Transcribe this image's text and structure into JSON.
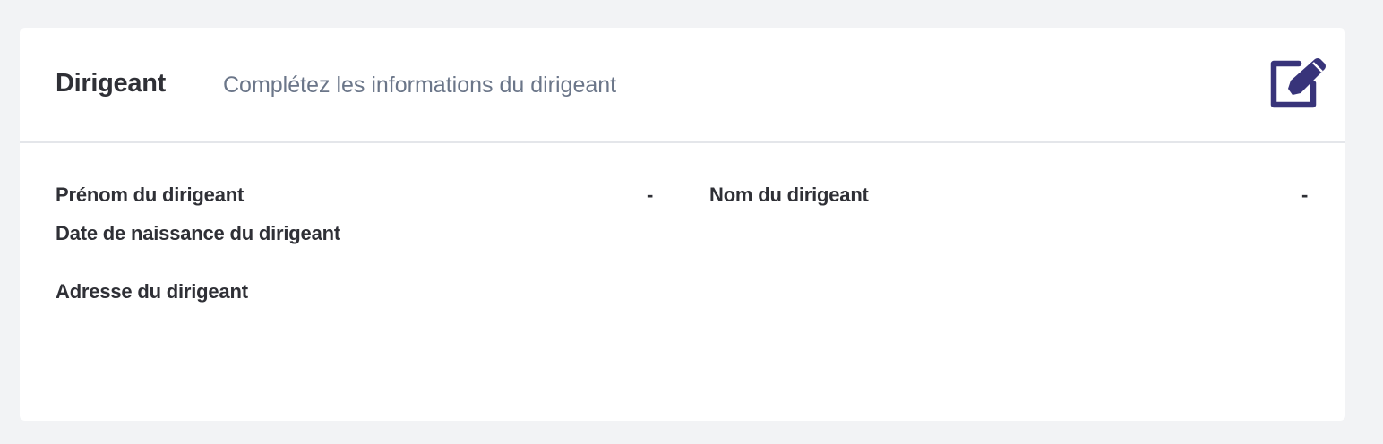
{
  "card": {
    "title": "Dirigeant",
    "subtitle": "Complétez les informations du dirigeant",
    "edit_icon": "edit-icon",
    "accent_color": "#38347a"
  },
  "fields": {
    "first_name": {
      "label": "Prénom du dirigeant",
      "value": "-"
    },
    "last_name": {
      "label": "Nom du dirigeant",
      "value": "-"
    },
    "birth_date": {
      "label": "Date de naissance du dirigeant"
    },
    "address": {
      "label": "Adresse du dirigeant"
    }
  }
}
